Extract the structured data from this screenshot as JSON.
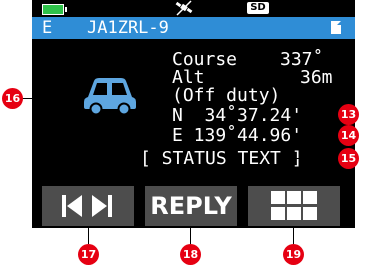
{
  "status_bar": {
    "battery_icon": "battery-full-icon",
    "gps_icon": "gps-satellite-off-icon",
    "sd_label": "SD"
  },
  "title_bar": {
    "band": "E",
    "callsign": "JA1ZRL-9",
    "page_icon": "document-icon",
    "background_color": "#2f8dd6"
  },
  "station": {
    "symbol_icon": "car-icon",
    "course_label": "Course",
    "course_value": "337˚",
    "alt_label": "Alt",
    "alt_value": "36m",
    "status": "(Off duty)",
    "lat": "N  34˚37.24'",
    "lon": "E 139˚44.96'",
    "status_text": "[ STATUS TEXT ]"
  },
  "softkeys": [
    {
      "icon": "skip-prev-next-icon"
    },
    {
      "label": "REPLY"
    },
    {
      "icon": "grid-menu-icon"
    }
  ],
  "callouts": {
    "c13": "13",
    "c14": "14",
    "c15": "15",
    "c16": "16",
    "c17": "17",
    "c18": "18",
    "c19": "19"
  }
}
